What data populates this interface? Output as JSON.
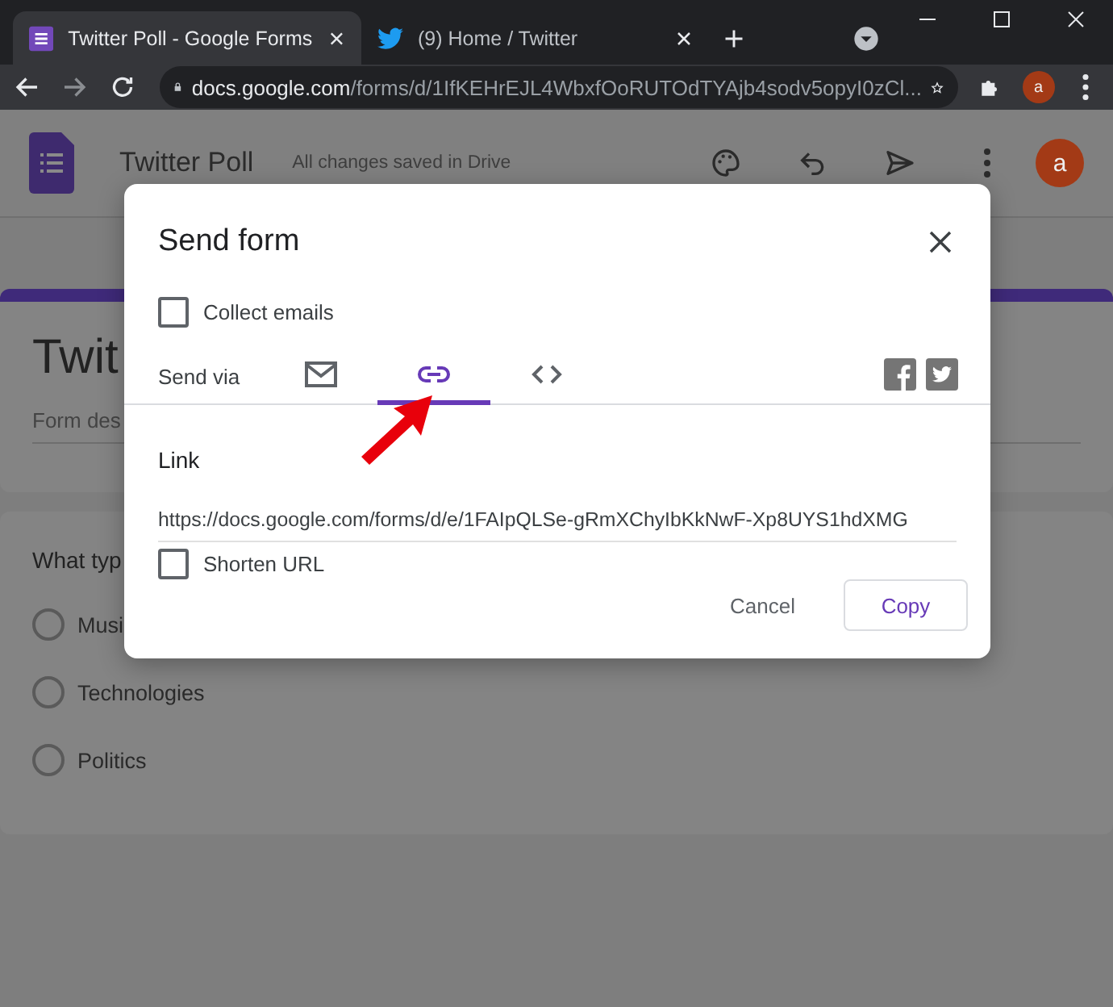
{
  "browser": {
    "tabs": [
      {
        "title": "Twitter Poll - Google Forms",
        "selected": true,
        "kind": "forms"
      },
      {
        "title": "(9) Home / Twitter",
        "selected": false,
        "kind": "bird"
      }
    ],
    "address": {
      "host": "docs.google.com",
      "path": "/forms/d/1IfKEHrEJL4WbxfOoRUTOdTYAjb4sodv5opyI0zCl..."
    },
    "profile_initial": "a"
  },
  "header": {
    "title": "Twitter Poll",
    "status": "All changes saved in Drive",
    "avatar_initial": "a"
  },
  "form": {
    "title": "Twit",
    "description": "Form des",
    "question": "What typ",
    "options": [
      {
        "label": "Musi",
        "selected": false
      },
      {
        "label": "Technologies",
        "selected": false
      },
      {
        "label": "Politics",
        "selected": false
      }
    ]
  },
  "dialog": {
    "title": "Send form",
    "collect_emails": {
      "label": "Collect emails",
      "checked": false
    },
    "send_via_label": "Send via",
    "tabs": [
      {
        "kind": "email",
        "selected": false
      },
      {
        "kind": "link",
        "selected": true
      },
      {
        "kind": "embed",
        "selected": false
      }
    ],
    "link_heading": "Link",
    "link_url": "https://docs.google.com/forms/d/e/1FAIpQLSe-gRmXChyIbKkNwF-Xp8UYS1hdXMG",
    "shorten_url": {
      "label": "Shorten URL",
      "checked": false
    },
    "cancel": "Cancel",
    "copy": "Copy"
  }
}
